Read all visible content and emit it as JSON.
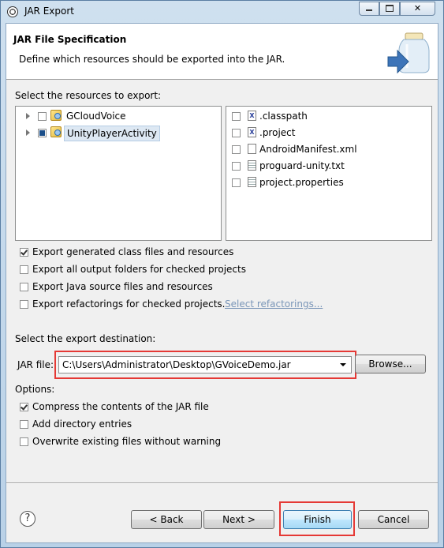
{
  "window": {
    "title": "JAR Export"
  },
  "banner": {
    "title": "JAR File Specification",
    "description": "Define which resources should be exported into the JAR."
  },
  "resources": {
    "label": "Select the resources to export:",
    "projects": [
      {
        "name": "GCloudVoice",
        "state": "unchecked"
      },
      {
        "name": "UnityPlayerActivity",
        "state": "partial",
        "selected": true
      }
    ],
    "files": [
      {
        "name": ".classpath",
        "icon": "x-file-icon"
      },
      {
        "name": ".project",
        "icon": "x-file-icon"
      },
      {
        "name": "AndroidManifest.xml",
        "icon": "file-icon"
      },
      {
        "name": "proguard-unity.txt",
        "icon": "text-file-icon"
      },
      {
        "name": "project.properties",
        "icon": "text-file-icon"
      }
    ]
  },
  "export_options": [
    {
      "label": "Export generated class files and resources",
      "checked": true
    },
    {
      "label": "Export all output folders for checked projects",
      "checked": false
    },
    {
      "label": "Export Java source files and resources",
      "checked": false
    },
    {
      "label": "Export refactorings for checked projects.",
      "checked": false
    }
  ],
  "select_refactorings_link": "Select refactorings...",
  "destination": {
    "label": "Select the export destination:",
    "jar_file_label": "JAR file:",
    "jar_file_value": "C:\\Users\\Administrator\\Desktop\\GVoiceDemo.jar",
    "browse_label": "Browse..."
  },
  "options": {
    "label": "Options:",
    "items": [
      {
        "label": "Compress the contents of the JAR file",
        "checked": true
      },
      {
        "label": "Add directory entries",
        "checked": false
      },
      {
        "label": "Overwrite existing files without warning",
        "checked": false
      }
    ]
  },
  "buttons": {
    "help": "?",
    "back": "< Back",
    "next": "Next >",
    "finish": "Finish",
    "cancel": "Cancel"
  },
  "colors": {
    "highlight_box": "#e53935",
    "default_button": "#3c7fb1"
  }
}
